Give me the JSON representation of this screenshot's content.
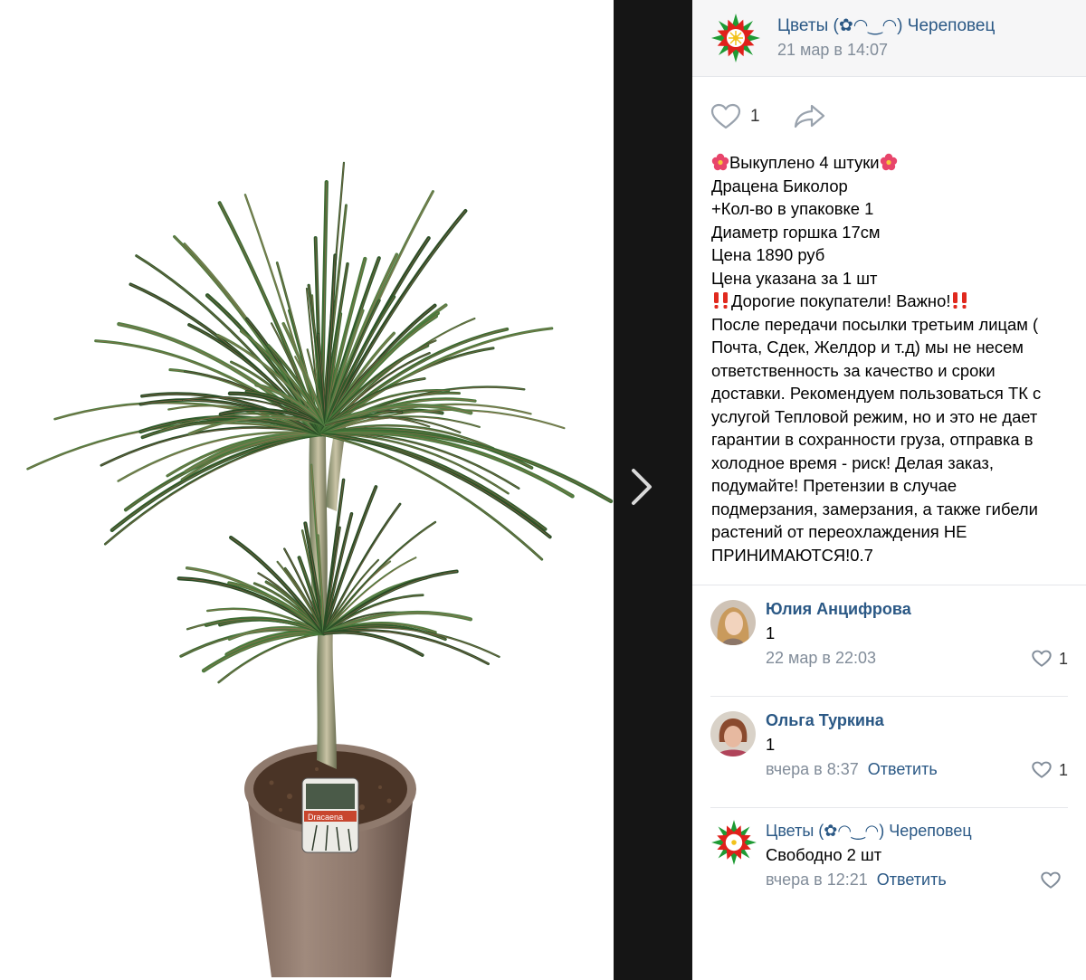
{
  "photo": {
    "label_text": "Dracaena"
  },
  "post": {
    "author": "Цветы (✿◠‿◠) Череповец",
    "date": "21 мар в 14:07",
    "likes": "1",
    "text_lines": [
      {
        "pre": "flower",
        "text": "Выкуплено 4 штуки",
        "post": "flower"
      },
      {
        "text": "Драцена Биколор"
      },
      {
        "text": "+Кол-во в упаковке 1"
      },
      {
        "text": "Диаметр горшка 17см"
      },
      {
        "text": "Цена 1890 руб"
      },
      {
        "text": "Цена указана за 1 шт"
      },
      {
        "pre": "bang",
        "text": "Дорогие покупатели! Важно!",
        "post": "bang"
      },
      {
        "text": "После передачи посылки третьим лицам ("
      },
      {
        "text": "Почта, Сдек, Желдор и т.д) мы не несем"
      },
      {
        "text": "ответственность за качество и сроки"
      },
      {
        "text": "доставки. Рекомендуем пользоваться ТК с"
      },
      {
        "text": "услугой Тепловой режим, но и это не дает"
      },
      {
        "text": "гарантии в сохранности груза, отправка в"
      },
      {
        "text": "холодное время - риск! Делая заказ,"
      },
      {
        "text": "подумайте! Претензии в случае"
      },
      {
        "text": "подмерзания, замерзания, а также гибели"
      },
      {
        "text": "растений от переохлаждения НЕ"
      },
      {
        "text": "ПРИНИМАЮТСЯ!0.7"
      }
    ]
  },
  "comments": [
    {
      "author": "Юлия Анцифрова",
      "text": "1",
      "time": "22 мар в 22:03",
      "reply": "",
      "likes": "1"
    },
    {
      "author": "Ольга Туркина",
      "text": "1",
      "time": "вчера в 8:37",
      "reply": "Ответить",
      "likes": "1"
    },
    {
      "author": "Цветы (✿◠‿◠) Череповец",
      "text": "Свободно 2 шт",
      "time": "вчера в 12:21",
      "reply": "Ответить",
      "likes": ""
    }
  ],
  "colors": {
    "link": "#2a5885",
    "meta": "#818c99",
    "dark_strip": "#151515"
  },
  "icons": [
    "heart-icon",
    "share-icon",
    "chevron-right-icon",
    "flower-emoji-icon",
    "double-exclamation-emoji-icon"
  ]
}
